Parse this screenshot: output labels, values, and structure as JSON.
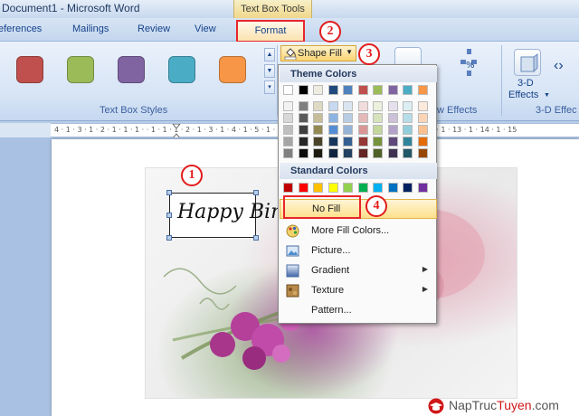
{
  "window": {
    "title": "Document1 - Microsoft Word",
    "contextual_tab_group": "Text Box Tools"
  },
  "tabs": [
    "eferences",
    "Mailings",
    "Review",
    "View",
    "Format"
  ],
  "ribbon": {
    "group_text_box_styles": "Text Box Styles",
    "shape_fill_label": "Shape Fill",
    "group_3d_effects_label": "3-D Effects",
    "group_shadow_partial": "w Effects",
    "group_3d_partial": "3-D Effec",
    "threed_button_label_line1": "3-D",
    "threed_button_label_line2": "Effects",
    "style_colors": [
      "#c0504d",
      "#9bbb59",
      "#8064a2",
      "#4bacc6",
      "#f79646"
    ]
  },
  "ruler_text": "4 · 1 · 3 · 1 · 2 · 1 · 1 · 1 ·        · 1 · 1 · 1 · 2 · 1 · 3 · 1 · 4 · 1 · 5 · 1 · 6 · 1 · 7 · 1 · 8 · 1 · 9 · 1 · 10 · 1 · 11 · 1 · 12 · 1 · 13 · 1 · 14 · 1 · 15",
  "textbox_text": "Happy Bir",
  "menu": {
    "theme_colors_label": "Theme Colors",
    "standard_colors_label": "Standard Colors",
    "theme_top_row": [
      "#ffffff",
      "#000000",
      "#eeece1",
      "#1f497d",
      "#4f81bd",
      "#c0504d",
      "#9bbb59",
      "#8064a2",
      "#4bacc6",
      "#f79646"
    ],
    "theme_shades": [
      [
        "#f2f2f2",
        "#7f7f7f",
        "#ddd9c3",
        "#c6d9f0",
        "#dbe5f1",
        "#f2dcdb",
        "#ebf1dd",
        "#e5e0ec",
        "#dbeef3",
        "#fdeada"
      ],
      [
        "#d8d8d8",
        "#595959",
        "#c4bd97",
        "#8db3e2",
        "#b8cce4",
        "#e5b9b7",
        "#d7e3bc",
        "#ccc1d9",
        "#b7dde8",
        "#fbd5b5"
      ],
      [
        "#bfbfbf",
        "#3f3f3f",
        "#938953",
        "#548dd4",
        "#95b3d7",
        "#d99694",
        "#c3d69b",
        "#b2a2c7",
        "#92cddc",
        "#fac08f"
      ],
      [
        "#a5a5a5",
        "#262626",
        "#494429",
        "#17365d",
        "#366092",
        "#953734",
        "#76923c",
        "#5f497a",
        "#31859b",
        "#e36c09"
      ],
      [
        "#7f7f7f",
        "#0c0c0c",
        "#1d1b10",
        "#0f243e",
        "#244061",
        "#632423",
        "#4f6128",
        "#3f3151",
        "#205867",
        "#974806"
      ]
    ],
    "standard_colors": [
      "#c00000",
      "#ff0000",
      "#ffc000",
      "#ffff00",
      "#92d050",
      "#00b050",
      "#00b0f0",
      "#0070c0",
      "#002060",
      "#7030a0"
    ],
    "items": [
      {
        "label": "No Fill"
      },
      {
        "label": "More Fill Colors..."
      },
      {
        "label": "Picture..."
      },
      {
        "label": "Gradient"
      },
      {
        "label": "Texture"
      },
      {
        "label": "Pattern..."
      }
    ]
  },
  "callouts": [
    "1",
    "2",
    "3",
    "4"
  ],
  "watermark": {
    "part1": "NapTruc",
    "part2": "Tuyen",
    "part3": ".com"
  }
}
